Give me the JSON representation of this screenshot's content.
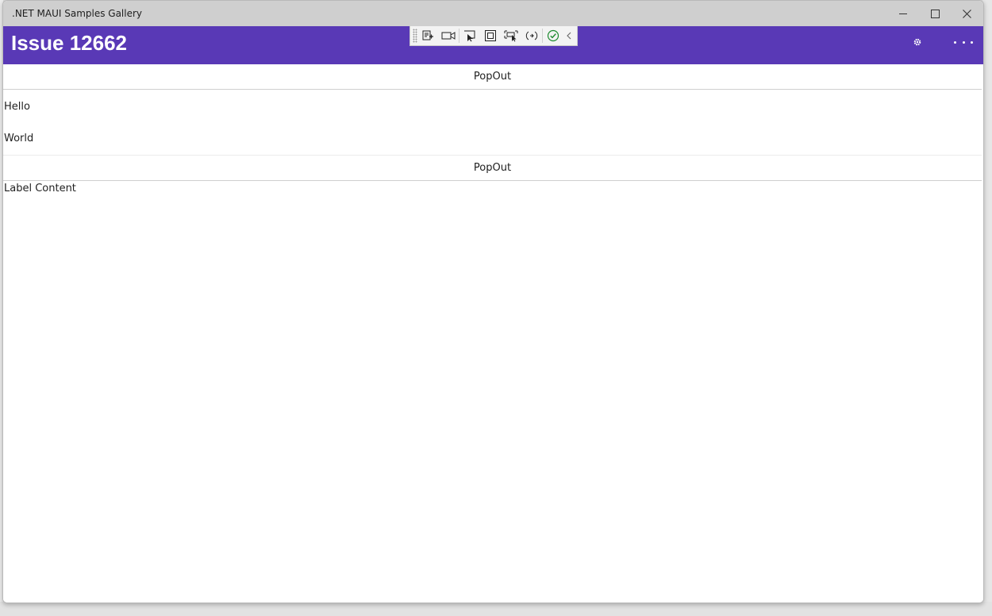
{
  "window": {
    "title": ".NET MAUI Samples Gallery"
  },
  "navbar": {
    "title": "Issue 12662",
    "accent_color": "#5939b6",
    "toolbar_icons": [
      "gear-icon",
      "more-icon"
    ]
  },
  "dev_toolbar": {
    "tools": [
      "go-to-live-visual-tree-icon",
      "record-icon",
      "select-element-icon",
      "display-layout-adorners-icon",
      "track-focus-icon",
      "hot-reload-icon",
      "binding-ok-icon",
      "collapse-icon"
    ]
  },
  "content": {
    "popout_1": "PopOut",
    "label_hello": "Hello",
    "label_world": "World",
    "popout_2": "PopOut",
    "label_content": "Label Content"
  }
}
